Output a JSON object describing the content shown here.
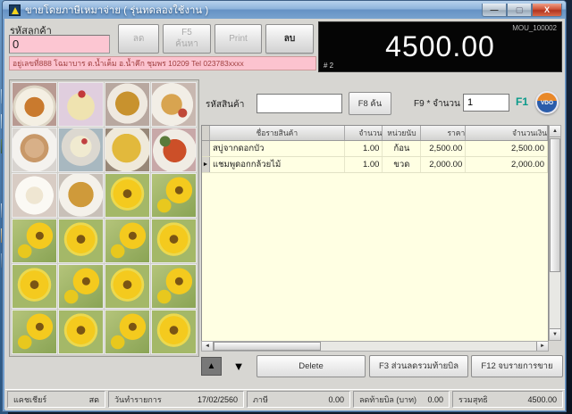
{
  "window": {
    "title": "ขายโดยภาษีเหมาจ่าย ( รุ่นทดลองใช้งาน )",
    "minimize_glyph": "—",
    "maximize_glyph": "▢",
    "close_glyph": "X"
  },
  "header": {
    "customer_code_label": "รหัสลูกค้า",
    "customer_code_value": "0",
    "buttons": {
      "discount": "ลด",
      "search": "F5 ค้นหา",
      "print": "Print",
      "delete": "ลบ"
    },
    "address": "อยู่เลขที่888 โฉมาบาร ต.น้ำเค็ม อ.น้ำคึก ชุมพร 10209 Tel 023783xxxx"
  },
  "display": {
    "doc_no": "MOU_100002",
    "amount": "4500.00",
    "line_no": "# 2"
  },
  "entry": {
    "product_code_label": "รหัสสินค้า",
    "product_code_value": "",
    "f8_label": "F8 ค้น",
    "qty_label": "F9 * จำนวน",
    "qty_value": "1",
    "f1_label": "F1",
    "badge_label": "VDO"
  },
  "table": {
    "headers": [
      "ชื่อรายสินค้า",
      "จำนวน",
      "หน่วยนับ",
      "ราคา",
      "จำนวนเงิน"
    ],
    "rows": [
      {
        "name": "สบู่จากดอกบัว",
        "qty": "1.00",
        "unit": "ก้อน",
        "price": "2,500.00",
        "amount": "2,500.00",
        "selected": false
      },
      {
        "name": "แชมพูดอกกล้วยไม้",
        "qty": "1.00",
        "unit": "ขวด",
        "price": "2,000.00",
        "amount": "2,000.00",
        "selected": true
      }
    ]
  },
  "actions": {
    "up_glyph": "▲",
    "down_glyph": "▼",
    "delete_label": "Delete",
    "f3_label": "F3 ส่วนลดรวมท้ายบิล",
    "f12_label": "F12 จบรายการขาย"
  },
  "statusbar": {
    "cashier_label": "แคชเชียร์",
    "cashier_value": "สด",
    "date_label": "วันทำรายการ",
    "date_value": "17/02/2560",
    "tax_label": "ภาษี",
    "tax_value": "0.00",
    "discount_label": "ลดท้ายบิล (บาท)",
    "discount_value": "0.00",
    "total_label": "รวมสุทธิ",
    "total_value": "4500.00"
  },
  "gallery": {
    "items": [
      "bowl-orange",
      "cake-cream",
      "fried-gold",
      "fried-plate",
      "chicken-pile",
      "dessert-cup",
      "curry-yellow",
      "stirfry-red",
      "soup-white",
      "rice-fried",
      "sun-a",
      "sun-b",
      "sun-b",
      "sun-a",
      "sun-b",
      "sun-a",
      "sun-a",
      "sun-b",
      "sun-a",
      "sun-b",
      "sun-b",
      "sun-a",
      "sun-b",
      "sun-a"
    ]
  }
}
